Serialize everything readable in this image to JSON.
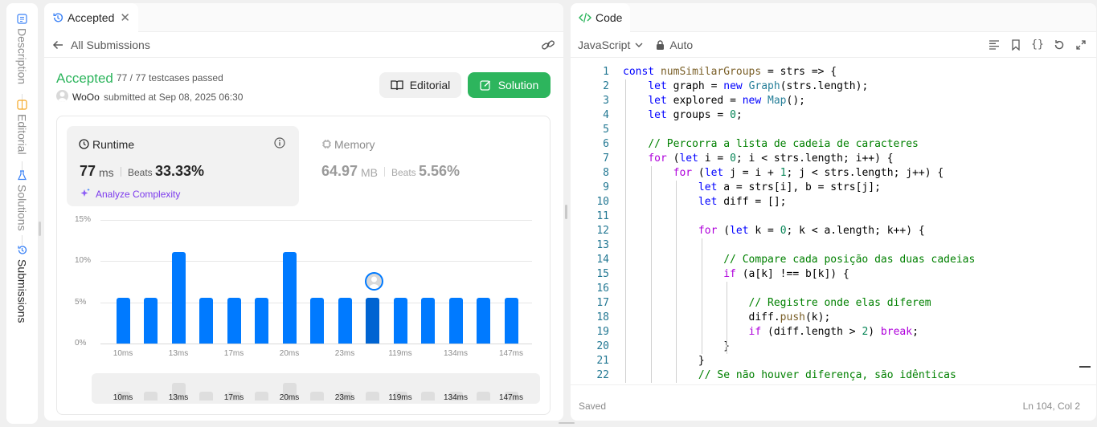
{
  "vertical_tabs": [
    {
      "label": "Description",
      "icon": "description-icon"
    },
    {
      "label": "Editorial",
      "icon": "editorial-icon"
    },
    {
      "label": "Solutions",
      "icon": "solutions-icon"
    },
    {
      "label": "Submissions",
      "icon": "history-icon"
    }
  ],
  "left": {
    "tab_title": "Accepted",
    "back_label": "All Submissions",
    "status": "Accepted",
    "testcases": "77 / 77 testcases passed",
    "user": "WoOo",
    "submitted": "submitted at Sep 08, 2025 06:30",
    "editorial_btn": "Editorial",
    "solution_btn": "Solution",
    "runtime": {
      "title": "Runtime",
      "value": "77",
      "unit": "ms",
      "beats_label": "Beats",
      "beats": "33.33%",
      "analyze": "Analyze Complexity"
    },
    "memory": {
      "title": "Memory",
      "value": "64.97",
      "unit": "MB",
      "beats_label": "Beats",
      "beats": "5.56%"
    }
  },
  "chart_data": {
    "type": "bar",
    "title": "",
    "xlabel": "",
    "ylabel": "",
    "ylim": [
      0,
      15
    ],
    "y_ticks": [
      "15%",
      "10%",
      "5%",
      "0%"
    ],
    "x_tick_labels": [
      "10ms",
      "13ms",
      "17ms",
      "20ms",
      "23ms",
      "119ms",
      "134ms",
      "147ms"
    ],
    "values": [
      5.56,
      5.56,
      11.11,
      5.56,
      5.56,
      5.56,
      11.11,
      5.56,
      5.56,
      5.56,
      5.56,
      5.56,
      5.56,
      5.56,
      5.56
    ],
    "selected_index": 9,
    "colors": {
      "bar": "#007aff",
      "selected": "#0064d2",
      "mini": "#dedede"
    }
  },
  "right": {
    "tab_title": "Code",
    "language": "JavaScript",
    "mode": "Auto",
    "status": "Saved",
    "cursor": "Ln 104, Col 2",
    "code_lines": [
      "const numSimilarGroups = strs => {",
      "    let graph = new Graph(strs.length);",
      "    let explored = new Map();",
      "    let groups = 0;",
      "",
      "    // Percorra a lista de cadeia de caracteres",
      "    for (let i = 0; i < strs.length; i++) {",
      "        for (let j = i + 1; j < strs.length; j++) {",
      "            let a = strs[i], b = strs[j];",
      "            let diff = [];",
      "",
      "            for (let k = 0; k < a.length; k++) {",
      "",
      "                // Compare cada posição das duas cadeias",
      "                if (a[k] !== b[k]) {",
      "",
      "                    // Registre onde elas diferem",
      "                    diff.push(k);",
      "                    if (diff.length > 2) break;",
      "                }",
      "            }",
      "            // Se não houver diferença, são idênticas"
    ]
  }
}
